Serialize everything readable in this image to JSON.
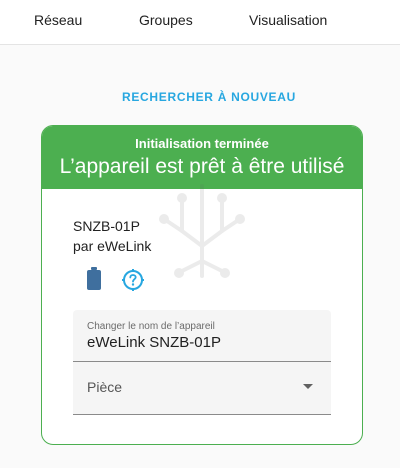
{
  "tabs": [
    {
      "label": "Réseau"
    },
    {
      "label": "Groupes"
    },
    {
      "label": "Visualisation"
    }
  ],
  "rescan_label": "RECHERCHER À NOUVEAU",
  "card": {
    "status": "Initialisation terminée",
    "headline": "L’appareil est prêt à être utilisé",
    "device": {
      "model": "SNZB-01P",
      "manufacturer": "par eWeLink",
      "icons": [
        "battery-icon",
        "help-icon"
      ]
    },
    "name_field": {
      "label": "Changer le nom de l’appareil",
      "value": "eWeLink SNZB-01P"
    },
    "room_field": {
      "placeholder": "Pièce"
    }
  },
  "colors": {
    "accent": "#27a7e0",
    "success": "#4caf50",
    "battery_icon": "#3f6f9e",
    "help_icon": "#27a7e0"
  }
}
